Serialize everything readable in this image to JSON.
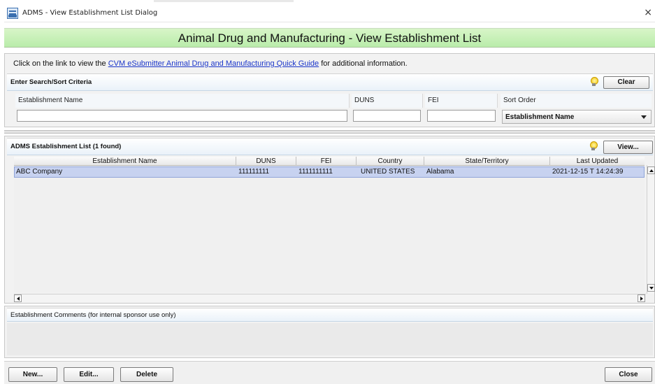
{
  "window": {
    "title": "ADMS - View Establishment List Dialog",
    "close_glyph": "×",
    "app_icon": "adms-app-icon"
  },
  "banner": {
    "title": "Animal Drug and Manufacturing - View Establishment List",
    "color": "#c6efb6"
  },
  "info": {
    "prefix": "Click on the link to view the ",
    "link_text": "CVM eSubmitter Animal Drug and Manufacturing Quick Guide",
    "suffix": " for additional information."
  },
  "search": {
    "header": "Enter Search/Sort Criteria",
    "clear_label": "Clear",
    "columns": {
      "name": "Establishment Name",
      "duns": "DUNS",
      "fei": "FEI",
      "sort": "Sort Order"
    },
    "values": {
      "name": "",
      "duns": "",
      "fei": ""
    },
    "sort_selected": "Establishment Name"
  },
  "list": {
    "header": "ADMS Establishment List  (1 found)",
    "view_label": "View...",
    "columns": [
      "Establishment Name",
      "DUNS",
      "FEI",
      "Country",
      "State/Territory",
      "Last Updated"
    ],
    "rows": [
      {
        "name": "ABC Company",
        "duns": "111111111",
        "fei": "1111111111",
        "country": "UNITED STATES",
        "state": "Alabama",
        "updated": "2021-12-15 T 14:24:39"
      }
    ],
    "selected_row_color": "#c7d2f0"
  },
  "comments": {
    "header": "Establishment Comments (for internal sponsor use only)",
    "text": ""
  },
  "footer": {
    "new_label": "New...",
    "edit_label": "Edit...",
    "delete_label": "Delete",
    "close_label": "Close"
  }
}
